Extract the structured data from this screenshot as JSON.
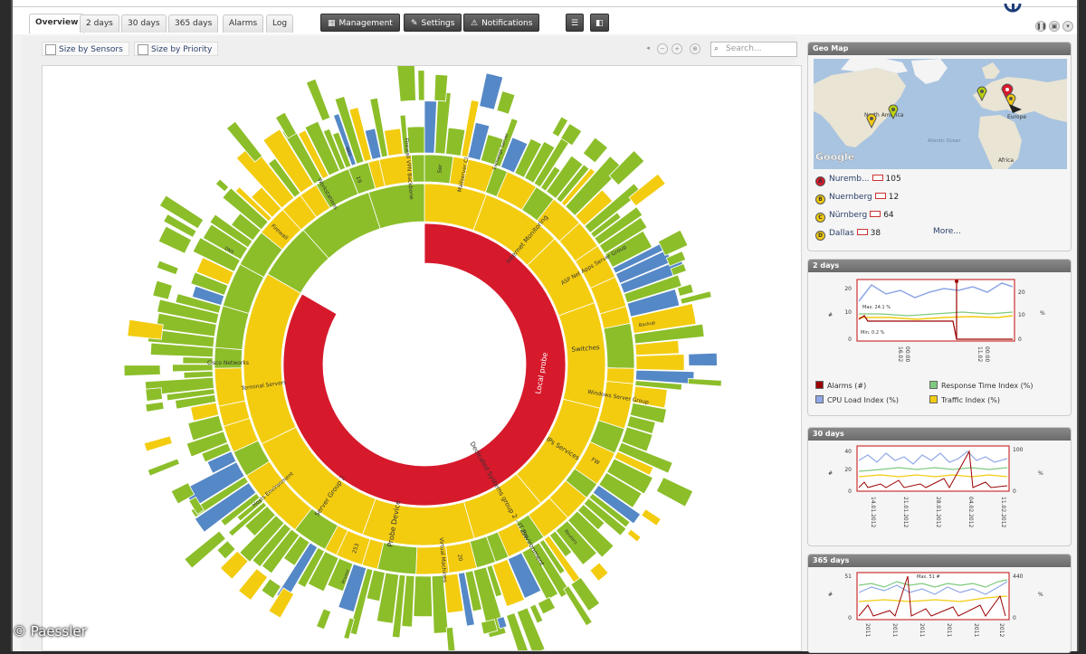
{
  "tabs": [
    {
      "label": "Overview",
      "active": true
    },
    {
      "label": "2 days"
    },
    {
      "label": "30 days"
    },
    {
      "label": "365 days"
    },
    {
      "label": "Alarms"
    },
    {
      "label": "Log"
    }
  ],
  "toolbar_buttons": {
    "management": "Management",
    "settings": "Settings",
    "notifications": "Notifications"
  },
  "view_options": {
    "size_by_sensors": "Size by Sensors",
    "size_by_priority": "Size by Priority"
  },
  "search": {
    "placeholder": "Search..."
  },
  "sunburst": {
    "center_label": "Local probe",
    "labels": [
      "Probe Device",
      "Dedicated Systems group 2 - IT Environment",
      "Internet Monitoring",
      "Switches",
      "Server Group 2",
      "Terminal Servers",
      "IPs Services",
      "Firewall",
      "Workstations",
      "Mailserver Cl...",
      "Firewall VPN Backbone",
      "ASP Net Apps Server Group",
      "Windows Server Group",
      "Virtual Machines",
      "Hosts Environment",
      "Cisco Networks",
      "Exchange Server",
      "Backup",
      "Routers",
      "Printer",
      "DNS",
      "Web",
      "250",
      "253",
      "20",
      "19",
      "Ser",
      "FW"
    ],
    "colors": {
      "core": "#d7192c",
      "yellow": "#f3cc10",
      "green": "#8cbe2a",
      "blue": "#5588c6"
    }
  },
  "geomap": {
    "title": "Geo Map",
    "map_labels": {
      "north_america": "North America",
      "europe": "Europe",
      "africa": "Africa",
      "atlantic": "Atlantic Ocean",
      "google": "Google"
    },
    "locations": [
      {
        "marker": "A",
        "color": "#d7192c",
        "name": "Nuremb...",
        "value": "105"
      },
      {
        "marker": "B",
        "color": "#f3cc10",
        "name": "Nuernberg",
        "value": "12"
      },
      {
        "marker": "C",
        "color": "#f3cc10",
        "name": "Nürnberg",
        "value": "64"
      },
      {
        "marker": "D",
        "color": "#f3cc10",
        "name": "Dallas",
        "value": "38"
      }
    ],
    "more": "More..."
  },
  "graph_2days": {
    "title": "2 days",
    "y_left": [
      "20",
      "10",
      "0"
    ],
    "y_right": [
      "20",
      "10",
      "0"
    ],
    "x_ticks": [
      "16.02",
      "11.02"
    ],
    "x_sub": [
      "00:00",
      "00:00"
    ],
    "notes": [
      "Max. 24.1 %",
      "Min. 0.2 %"
    ],
    "legend": [
      {
        "label": "Alarms (#)",
        "color": "#9b0000"
      },
      {
        "label": "Response Time Index (%)",
        "color": "#7ecb7e"
      },
      {
        "label": "CPU Load Index (%)",
        "color": "#8fa7e6"
      },
      {
        "label": "Traffic Index (%)",
        "color": "#f3cc10"
      }
    ]
  },
  "graph_30days": {
    "title": "30 days",
    "y_left": [
      "40",
      "20",
      "0"
    ],
    "y_right": [
      "100",
      "0"
    ],
    "x_ticks": [
      "14.01.2012",
      "21.01.2012",
      "28.01.2012",
      "04.02.2012",
      "11.02.2012"
    ]
  },
  "graph_365days": {
    "title": "365 days",
    "y_left": [
      "51",
      "0"
    ],
    "y_right": [
      "440",
      "0"
    ],
    "max_note": "Max. 51 #",
    "x_ticks": [
      "2011",
      "2011",
      "2011",
      "2011",
      "2011",
      "2012"
    ]
  },
  "copyright": "© Paessler"
}
